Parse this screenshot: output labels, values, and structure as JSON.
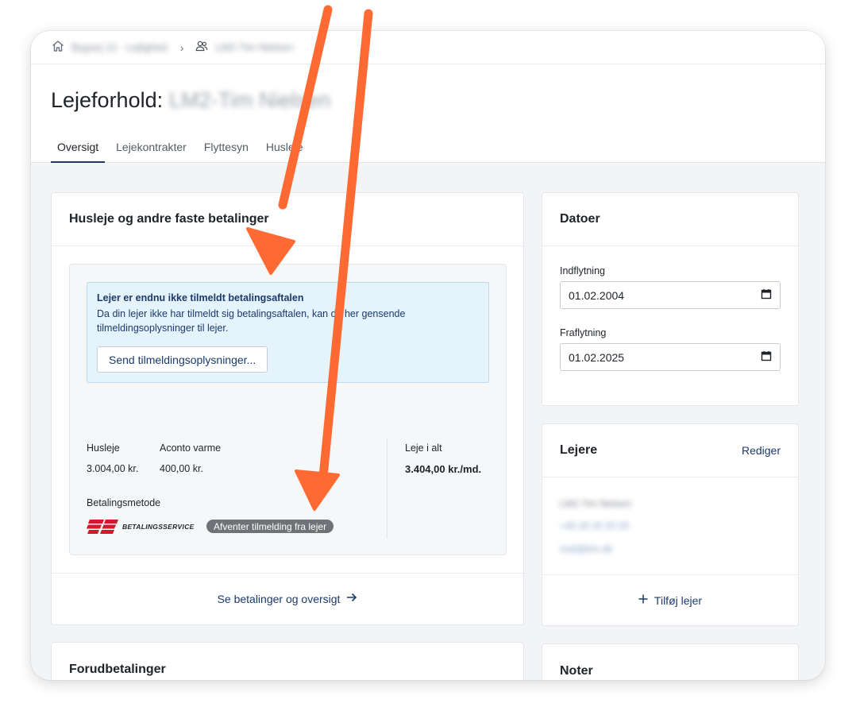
{
  "breadcrumb": {
    "property": "Bygvej 12 · Lejlighed",
    "tenancy": "LM2-Tim Nielsen"
  },
  "page": {
    "title_prefix": "Lejeforhold:",
    "title_name": "LM2-Tim Nielsen"
  },
  "tabs": [
    {
      "label": "Oversigt",
      "active": true
    },
    {
      "label": "Lejekontrakter",
      "active": false
    },
    {
      "label": "Flyttesyn",
      "active": false
    },
    {
      "label": "Husleje",
      "active": false
    }
  ],
  "payments": {
    "title": "Husleje og andre faste betalinger",
    "alert_title": "Lejer er endnu ikke tilmeldt betalingsaftalen",
    "alert_text": "Da din lejer ikke har tilmeldt sig betalingsaftalen, kan du her gensende tilmeldingsoplysninger til lejer.",
    "alert_button": "Send tilmeldingsoplysninger...",
    "rent_label": "Husleje",
    "rent_value": "3.004,00 kr.",
    "heating_label": "Aconto varme",
    "heating_value": "400,00 kr.",
    "total_label": "Leje i alt",
    "total_value": "3.404,00 kr./md.",
    "method_label": "Betalingsmetode",
    "method_logo_text": "BETALINGSSERVICE",
    "status_badge": "Afventer tilmelding fra lejer",
    "footer_link": "Se betalinger og oversigt"
  },
  "dates": {
    "title": "Datoer",
    "move_in_label": "Indflytning",
    "move_in_value": "01.02.2004",
    "move_out_label": "Fraflytning",
    "move_out_value": "01.02.2025"
  },
  "tenants": {
    "title": "Lejere",
    "edit_link": "Rediger",
    "name": "LM2-Tim Nielsen",
    "phone": "+45 20 20 20 20",
    "email": "mail@tim.dk",
    "add_link": "Tilføj lejer"
  },
  "prepayments": {
    "title": "Forudbetalinger"
  },
  "notes": {
    "title": "Noter"
  },
  "colors": {
    "accent": "#1b3a6b",
    "alert_bg": "#e4f3fc",
    "badge_bg": "#6f7277",
    "arrow": "#ff6a33",
    "bs_red": "#d3182c"
  }
}
